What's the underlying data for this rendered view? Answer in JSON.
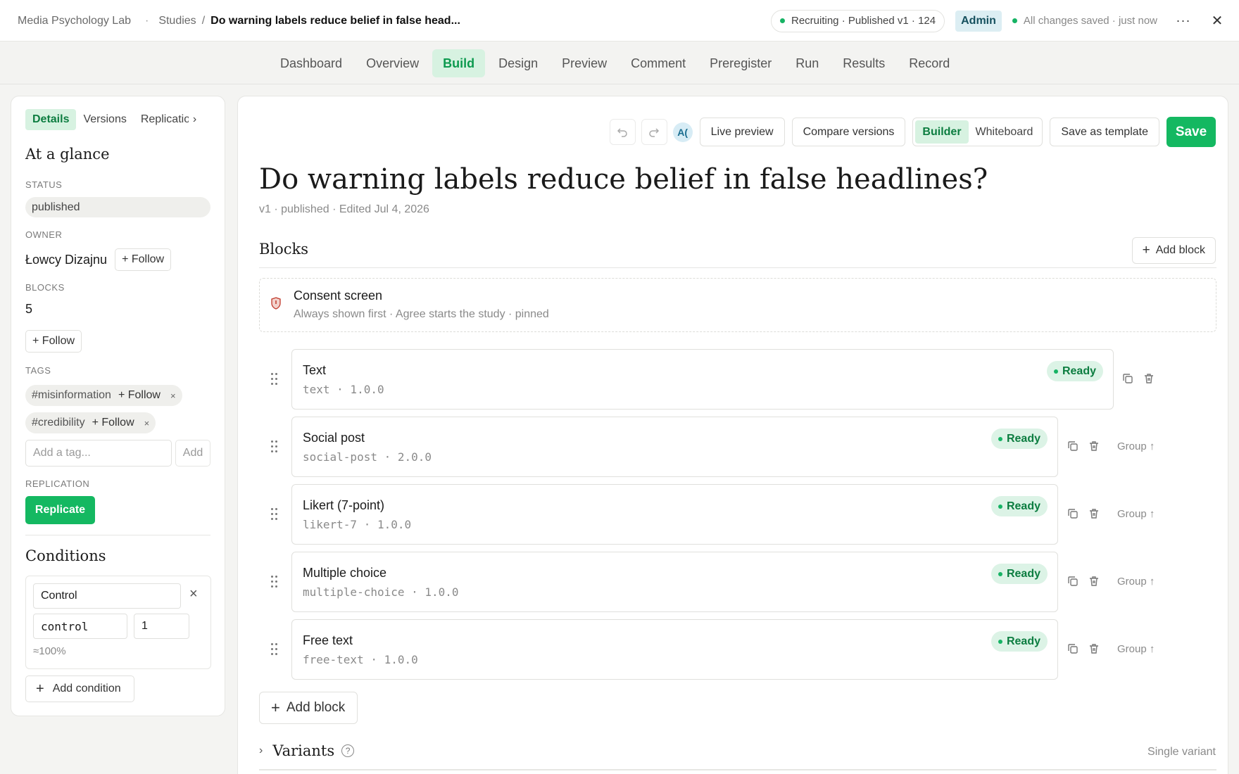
{
  "topbar": {
    "org": "Media Psychology Lab",
    "sep": "·",
    "studies": "Studies",
    "slash": "/",
    "current": "Do warning labels reduce belief in false head...",
    "status": "Recruiting · Published v1 · 124",
    "role": "Admin",
    "saved": "All changes saved · just now",
    "more": "···",
    "close": "✕"
  },
  "nav": {
    "tabs": [
      {
        "label": "Dashboard"
      },
      {
        "label": "Overview"
      },
      {
        "label": "Build",
        "active": true
      },
      {
        "label": "Design"
      },
      {
        "label": "Preview"
      },
      {
        "label": "Comment"
      },
      {
        "label": "Preregister"
      },
      {
        "label": "Run"
      },
      {
        "label": "Results"
      },
      {
        "label": "Record"
      }
    ]
  },
  "sidebar": {
    "tabs": [
      {
        "label": "Details",
        "active": true
      },
      {
        "label": "Versions"
      },
      {
        "label": "Replications"
      }
    ],
    "glance_title": "At a glance",
    "status_label": "STATUS",
    "status_value": "published",
    "owner_label": "OWNER",
    "owner_name": "Łowcy Dizajnu",
    "follow": "+ Follow",
    "blocks_label": "BLOCKS",
    "blocks_count": "5",
    "tags_label": "TAGS",
    "tags": [
      {
        "name": "#misinformation",
        "follow": "+ Follow",
        "remove": "×"
      },
      {
        "name": "#credibility",
        "follow": "+ Follow",
        "remove": "×"
      }
    ],
    "tag_placeholder": "Add a tag...",
    "tag_add": "Add",
    "replication_label": "REPLICATION",
    "replicate": "Replicate",
    "conditions_title": "Conditions",
    "condition": {
      "name": "Control",
      "key": "control",
      "weight": "1",
      "share": "≈100%"
    },
    "add_condition": "Add condition"
  },
  "toolbar": {
    "undo_icon": "undo-icon",
    "redo_icon": "redo-icon",
    "avatar": "A(",
    "live_preview": "Live preview",
    "compare": "Compare versions",
    "builder": "Builder",
    "whiteboard": "Whiteboard",
    "save_template": "Save as template",
    "save": "Save"
  },
  "study": {
    "title": "Do warning labels reduce belief in false headlines?",
    "meta": "v1 · published · Edited Jul 4, 2026"
  },
  "blocks": {
    "heading": "Blocks",
    "add_block": "Add block",
    "consent": {
      "title": "Consent screen",
      "subtitle": "Always shown first · Agree starts the study · pinned"
    },
    "items": [
      {
        "title": "Text",
        "type": "text · 1.0.0",
        "status": "Ready"
      },
      {
        "title": "Social post",
        "type": "social-post · 2.0.0",
        "status": "Ready",
        "group": "Group ↑"
      },
      {
        "title": "Likert (7-point)",
        "type": "likert-7 · 1.0.0",
        "status": "Ready",
        "group": "Group ↑"
      },
      {
        "title": "Multiple choice",
        "type": "multiple-choice · 1.0.0",
        "status": "Ready",
        "group": "Group ↑"
      },
      {
        "title": "Free text",
        "type": "free-text · 1.0.0",
        "status": "Ready",
        "group": "Group ↑"
      }
    ]
  },
  "variants": {
    "title": "Variants",
    "help": "?",
    "summary": "Single variant"
  },
  "colors": {
    "accent": "#14b861",
    "accent_soft": "#d7f2e1",
    "admin_bg": "#dceef3"
  }
}
